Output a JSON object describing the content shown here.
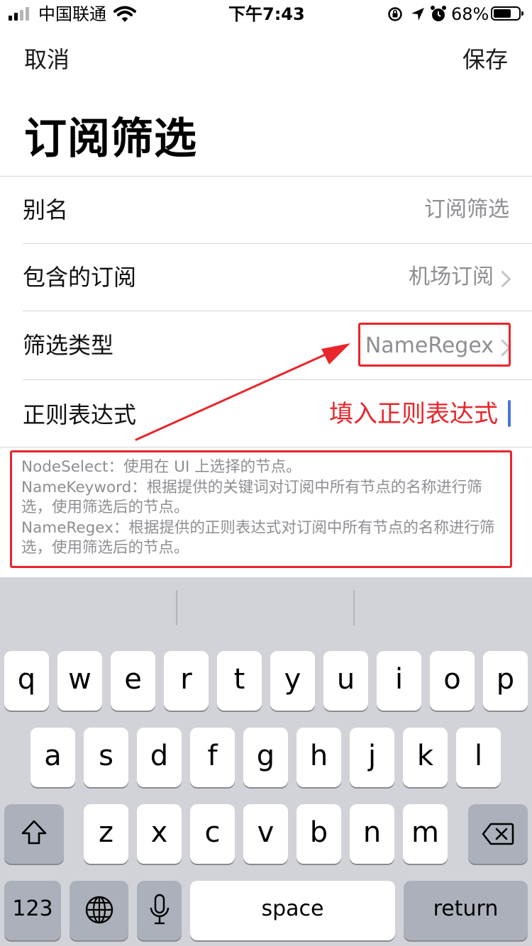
{
  "status_bar": {
    "carrier": "中国联通",
    "time": "下午7:43",
    "battery": "68%"
  },
  "nav": {
    "cancel": "取消",
    "save": "保存"
  },
  "title": "订阅筛选",
  "rows": [
    {
      "label": "别名",
      "value": "订阅筛选"
    },
    {
      "label": "包含的订阅",
      "value": "机场订阅"
    },
    {
      "label": "筛选类型",
      "value": "NameRegex"
    },
    {
      "label": "正则表达式",
      "value": ""
    }
  ],
  "annotation": "填入正则表达式",
  "help_lines": [
    "NodeSelect：使用在 UI 上选择的节点。",
    "NameKeyword：根据提供的关键词对订阅中所有节点的名称进行筛选，使用筛选后的节点。",
    "NameRegex：根据提供的正则表达式对订阅中所有节点的名称进行筛选，使用筛选后的节点。"
  ],
  "keyboard": {
    "row1": [
      "q",
      "w",
      "e",
      "r",
      "t",
      "y",
      "u",
      "i",
      "o",
      "p"
    ],
    "row2": [
      "a",
      "s",
      "d",
      "f",
      "g",
      "h",
      "j",
      "k",
      "l"
    ],
    "row3": [
      "z",
      "x",
      "c",
      "v",
      "b",
      "n",
      "m"
    ],
    "numbers": "123",
    "space": "space",
    "return": "return"
  },
  "colors": {
    "annotation_red": "#e8262c",
    "cursor_blue": "#4b73e6",
    "keyboard_bg": "#d1d3d9"
  }
}
